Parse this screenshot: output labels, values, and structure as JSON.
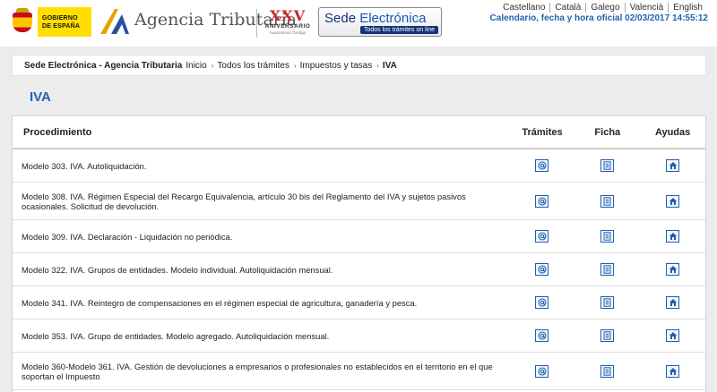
{
  "header": {
    "gob_line1": "GOBIERNO",
    "gob_line2": "DE ESPAÑA",
    "brand": "Agencia Tributaria",
    "xxv_num": "XXV",
    "xxv_line1": "ANIVERSARIO",
    "xxv_line2": "Avanzamos Contigo",
    "sede_a": "Sede ",
    "sede_b": "Electrónica",
    "sede_tag": "Todos los trámites on line",
    "languages": [
      "Castellano",
      "Català",
      "Galego",
      "Valencià",
      "English"
    ],
    "calendar": "Calendario, fecha y hora oficial 02/03/2017 14:55:12"
  },
  "breadcrumb": {
    "site": "Sede Electrónica - Agencia Tributaria",
    "items": [
      "Inicio",
      "Todos los trámites",
      "Impuestos y tasas",
      "IVA"
    ]
  },
  "page_title": "IVA",
  "table": {
    "headers": [
      "Procedimiento",
      "Trámites",
      "Ficha",
      "Ayudas"
    ],
    "rows": [
      "Modelo 303. IVA. Autoliquidación.",
      "Modelo 308. IVA. Régimen Especial del Recargo Equivalencia, artículo 30 bis del Reglamento del IVA y sujetos pasivos ocasionales. Solicitud de devolución.",
      "Modelo 309. IVA. Declaración - Liquidación no periódica.",
      "Modelo 322. IVA. Grupos de entidades. Modelo individual. Autoliquidación mensual.",
      "Modelo 341. IVA. Reintegro de compensaciones en el régimen especial de agricultura, ganadería y pesca.",
      "Modelo 353. IVA. Grupo de entidades. Modelo agregado. Autoliquidación mensual.",
      "Modelo 360-Modelo 361. IVA. Gestión de devoluciones a empresarios o profesionales no establecidos en el territorio en el que soportan el Impuesto"
    ]
  },
  "icons": {
    "tramites": "at-sign-icon",
    "ficha": "document-icon",
    "ayudas": "home-icon"
  },
  "colors": {
    "accent": "#2063b0",
    "breadcrumb_arrow": "#c0392b",
    "icon_border": "#1f5fae"
  }
}
